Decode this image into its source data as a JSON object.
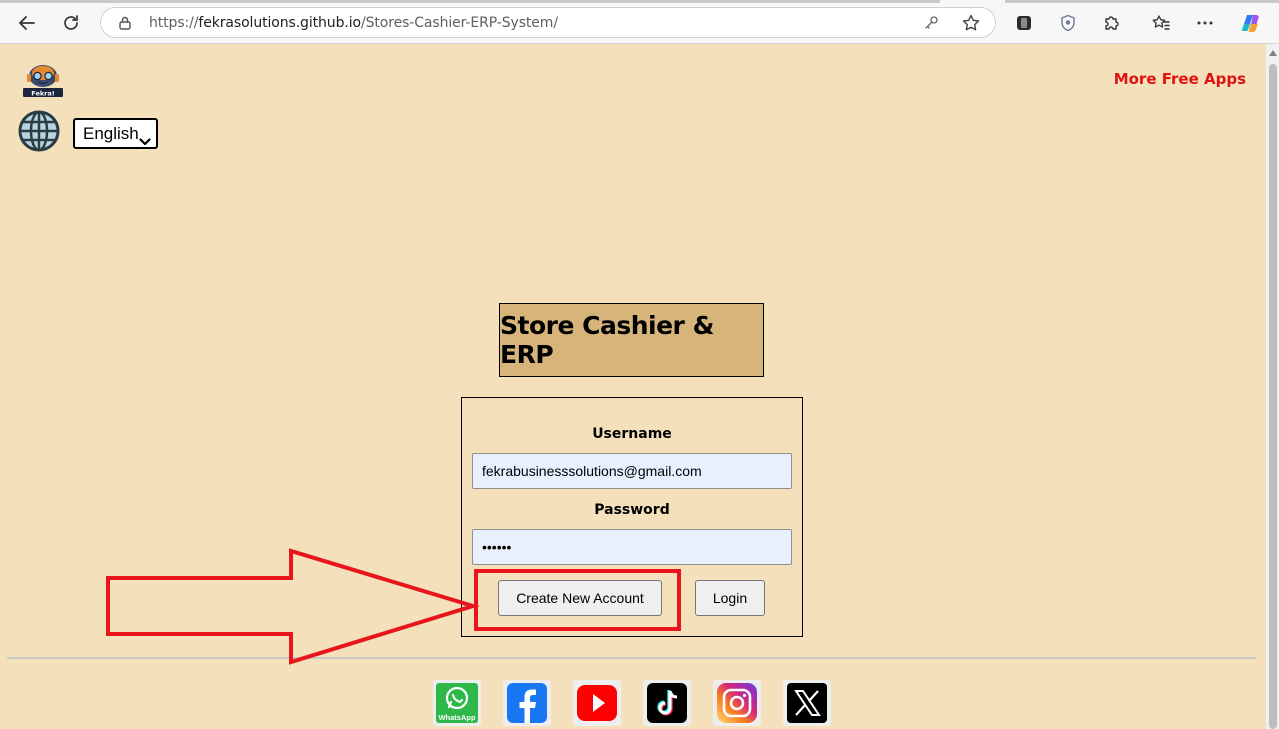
{
  "browser": {
    "url_prefix": "https://",
    "url_host": "fekrasolutions.github.io",
    "url_path": "/Stores-Cashier-ERP-System/"
  },
  "header": {
    "logo_text": "Fekra!",
    "more_apps": "More Free Apps",
    "language_selected": "English"
  },
  "app": {
    "title": "Store Cashier & ERP"
  },
  "login": {
    "username_label": "Username",
    "username_value": "fekrabusinesssolutions@gmail.com",
    "password_label": "Password",
    "password_value": "••••••",
    "create_button": "Create New Account",
    "login_button": "Login"
  },
  "social": [
    "whatsapp",
    "facebook",
    "youtube",
    "tiktok",
    "instagram",
    "x"
  ],
  "social_whatsapp_label": "WhatsApp",
  "colors": {
    "page_bg": "#f5e0bc",
    "title_bg": "#d6b47a",
    "accent_red": "#e0130f",
    "annotation_red": "#e8161c"
  }
}
